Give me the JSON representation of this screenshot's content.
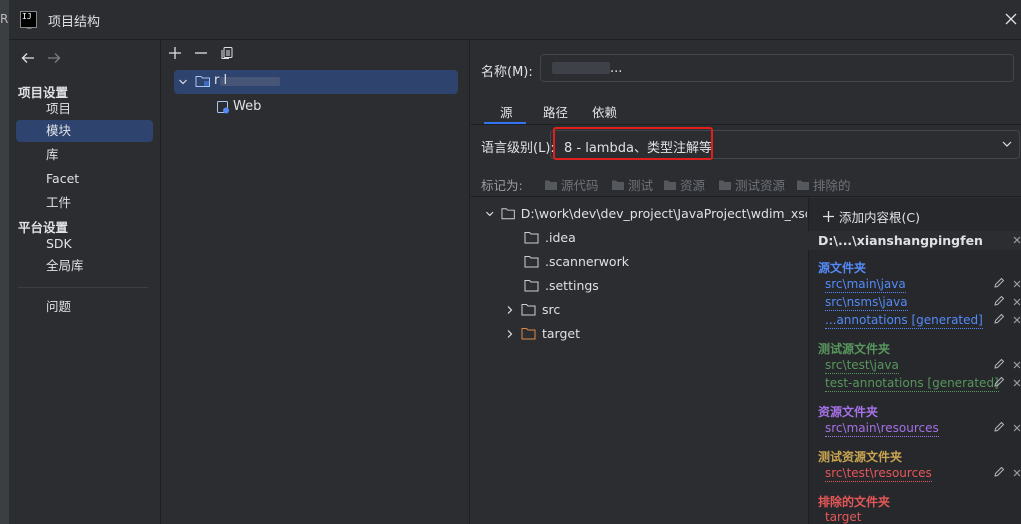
{
  "window": {
    "title": "项目结构",
    "edge_letter": "R"
  },
  "nav": {
    "project_settings_header": "项目设置",
    "project_items": [
      "项目",
      "模块",
      "库",
      "Facet",
      "工件"
    ],
    "platform_settings_header": "平台设置",
    "platform_items": [
      "SDK",
      "全局库"
    ],
    "problems": "问题",
    "selected": "模块"
  },
  "modules": {
    "module_name": "r         l      ",
    "facet": "Web"
  },
  "details": {
    "name_label": "名称(M):",
    "name_value": "",
    "name_value_suffix": "...",
    "tabs": [
      "源",
      "路径",
      "依赖"
    ],
    "active_tab": "源",
    "lang_label": "语言级别(L):",
    "lang_value": "8 - lambda、类型注解等",
    "mark_as_label": "标记为:",
    "mark_buttons": [
      "源代码",
      "测试",
      "资源",
      "测试资源",
      "排除的"
    ]
  },
  "content_tree": {
    "root": "D:\\work\\dev\\dev_project\\JavaProject\\wdim_xsdf\\",
    "children": [
      ".idea",
      ".scannerwork",
      ".settings",
      "src",
      "target"
    ]
  },
  "content_roots": {
    "add_label": "添加内容根(C)",
    "root_path": "D:\\...\\xianshangpingfen",
    "sections": [
      {
        "title": "源文件夹",
        "color": "#548af7",
        "items": [
          "src\\main\\java",
          "src\\nsms\\java",
          "...annotations [generated]"
        ]
      },
      {
        "title": "测试源文件夹",
        "color": "#57965c",
        "items": [
          "src\\test\\java",
          "test-annotations [generated]"
        ]
      },
      {
        "title": "资源文件夹",
        "color": "#a571e6",
        "items": [
          "src\\main\\resources"
        ]
      },
      {
        "title": "测试资源文件夹",
        "color": "#c7a450",
        "items": [
          "src\\test\\resources"
        ]
      },
      {
        "title": "排除的文件夹",
        "color": "#e55757",
        "items": [
          "target"
        ]
      }
    ]
  },
  "colors": {
    "accent": "#3574f0",
    "selection": "#2e436e",
    "highlight_box": "#e0201d",
    "folder_orange": "#d98a4a"
  }
}
